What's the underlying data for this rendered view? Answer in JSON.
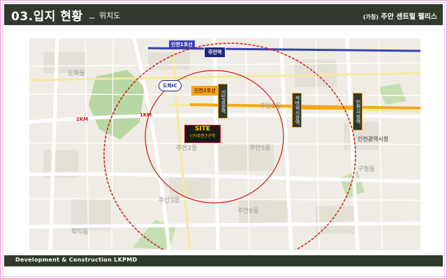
{
  "header": {
    "title": "03.입지 현황",
    "dash": "_",
    "subtitle": "위치도",
    "project_prefix": "(가칭)",
    "project_name": "주안 센트럴 팰리스"
  },
  "map": {
    "labels": {
      "line1": "인천1호선",
      "juan_station": "주안역",
      "dohwa_ic": "도화IC",
      "line2": "인천2호선",
      "city_hall_station_v": "시민공원역",
      "seokbawi_station_v": "석바위시장역",
      "incheon_city_hall_station_v": "인천시청역",
      "site_title": "SITE",
      "site_sub": "(구)주안7구역",
      "ring_1km": "1KM",
      "ring_2km": "2KM",
      "incheon_city_hall": "인천광역시청",
      "juan1": "주안1동",
      "juan2": "주안2동",
      "juan5": "주안5동",
      "juan3": "주안3동",
      "juan6": "주안6동",
      "dohwa": "도화동",
      "hakik": "학익동",
      "guwol": "구월동"
    }
  },
  "footer": {
    "text": "Development & Construction LKPMD"
  },
  "colors": {
    "header_bg": "#2f3a2c",
    "frame_pink": "#e79ad3",
    "circle_red": "#d01818",
    "line1_blue": "#3a3fb0",
    "line2_orange": "#f2a81d",
    "site_bg": "#1b1b1b",
    "site_text": "#f5d400"
  }
}
